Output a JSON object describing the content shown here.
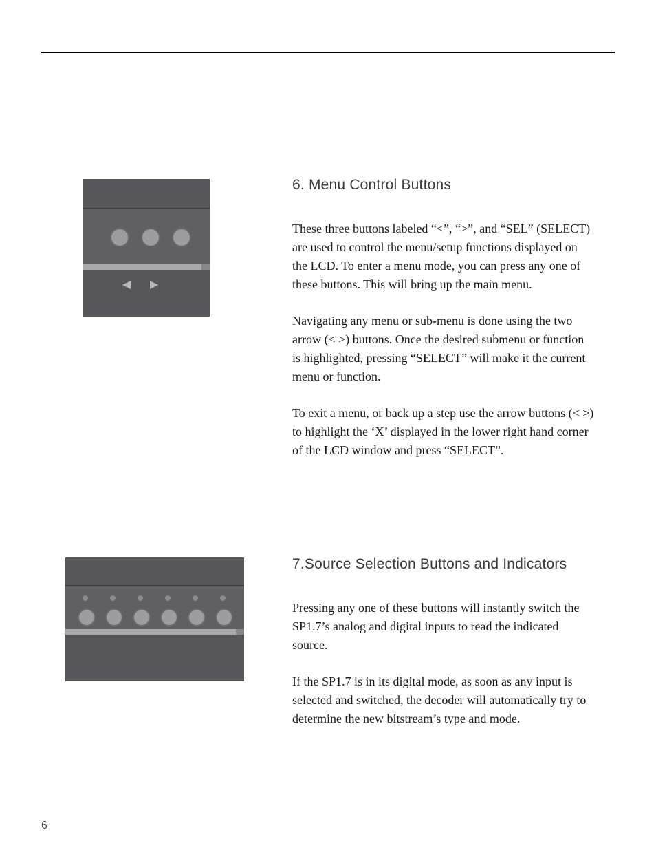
{
  "page_number": "6",
  "sections": [
    {
      "heading": "6. Menu Control Buttons",
      "paragraphs": [
        "These three buttons labeled “<”, “>”, and “SEL” (SELECT) are used to control the menu/setup functions displayed on the LCD. To enter a menu mode, you can press any one of these buttons. This will bring up the main menu.",
        "Navigating any menu or sub-menu is done using the two arrow (< >) buttons.  Once the desired submenu or function is highlighted, pressing “SELECT” will make it the current menu or function.",
        "To exit a menu, or back up a step use the arrow buttons (< >) to highlight the ‘X’ displayed in the lower right hand corner of the LCD window and press “SELECT”."
      ],
      "figure": "menu-control-buttons-panel"
    },
    {
      "heading": "7.Source Selection Buttons and Indicators",
      "paragraphs": [
        "Pressing any one of these buttons will instantly switch the SP1.7’s analog and digital inputs to read the indicated source.",
        "If the SP1.7 is in its digital mode, as soon as any input is selected and switched, the decoder will automatically try to determine the new bitstream’s type and mode."
      ],
      "figure": "source-selection-buttons-panel"
    }
  ]
}
